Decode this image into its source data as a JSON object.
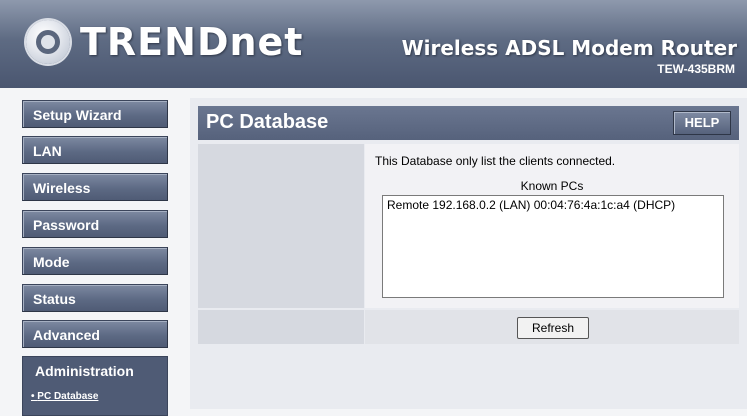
{
  "header": {
    "brand": "TRENDnet",
    "product_title": "Wireless ADSL Modem Router",
    "model": "TEW-435BRM"
  },
  "sidebar": {
    "items": [
      {
        "label": "Setup Wizard"
      },
      {
        "label": "LAN"
      },
      {
        "label": "Wireless"
      },
      {
        "label": "Password"
      },
      {
        "label": "Mode"
      },
      {
        "label": "Status"
      },
      {
        "label": "Advanced"
      }
    ],
    "admin": {
      "label": "Administration",
      "sublink": "PC Database"
    }
  },
  "main": {
    "title": "PC Database",
    "help_label": "HELP",
    "notice": "This Database only list the clients connected.",
    "list_label": "Known PCs",
    "pcs": [
      "Remote 192.168.0.2 (LAN) 00:04:76:4a:1c:a4 (DHCP)"
    ],
    "refresh_label": "Refresh"
  }
}
